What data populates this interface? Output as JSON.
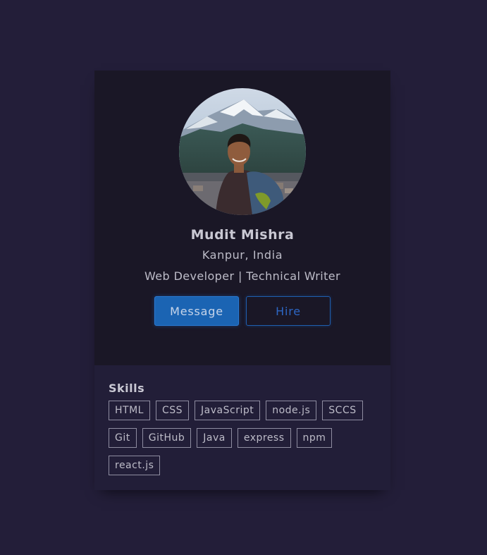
{
  "profile": {
    "avatar_alt": "user",
    "name": "Mudit Mishra",
    "location": "Kanpur, India",
    "role": "Web Developer | Technical Writer"
  },
  "actions": {
    "message_label": "Message",
    "hire_label": "Hire"
  },
  "skills": {
    "title": "Skills",
    "items": [
      "HTML",
      "CSS",
      "JavaScript",
      "node.js",
      "SCCS",
      "Git",
      "GitHub",
      "Java",
      "express",
      "npm",
      "react.js"
    ]
  },
  "colors": {
    "page_background": "#231e39",
    "card_background": "#1a1726",
    "skills_background": "#221e38",
    "primary_button": "#1b64b3",
    "ghost_button_border": "#1f5fb0"
  }
}
